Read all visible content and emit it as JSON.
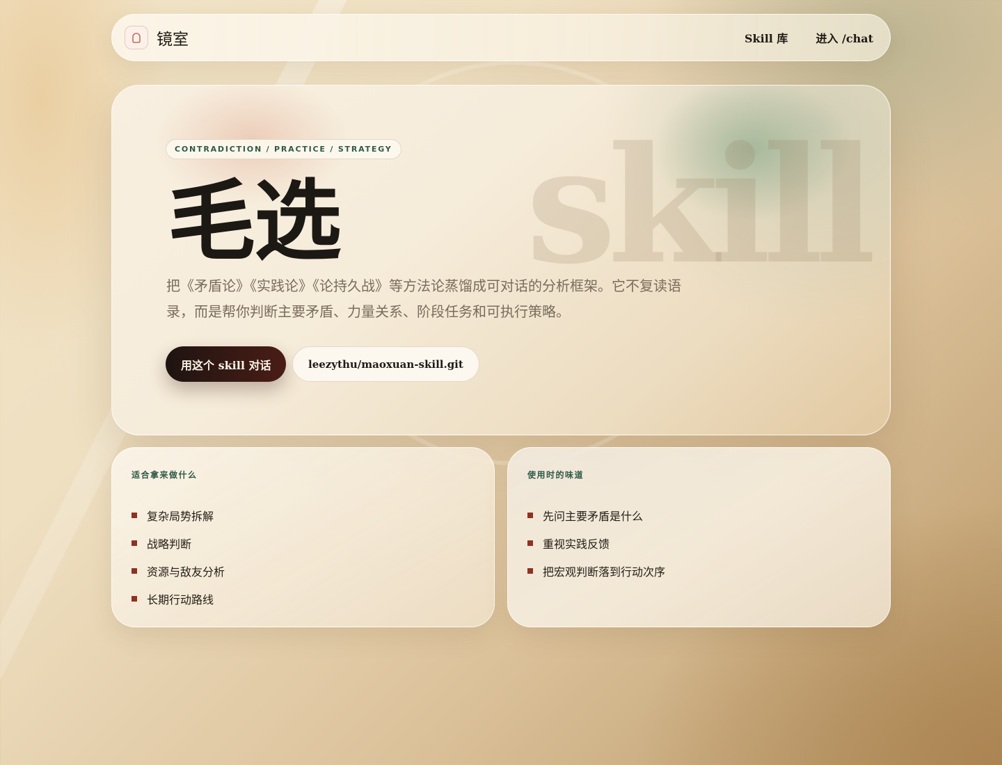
{
  "header": {
    "brand_name": "镜室",
    "nav": [
      {
        "label": "Skill 库"
      },
      {
        "label": "进入 /chat"
      }
    ]
  },
  "hero": {
    "eyebrow": "CONTRADICTION / PRACTICE / STRATEGY",
    "title": "毛选",
    "watermark": "skill",
    "description": "把《矛盾论》《实践论》《论持久战》等方法论蒸馏成可对话的分析框架。它不复读语录，而是帮你判断主要矛盾、力量关系、阶段任务和可执行策略。",
    "primary_button": "用这个 skill 对话",
    "secondary_button": "leezythu/maoxuan-skill.git"
  },
  "cards": [
    {
      "title": "适合拿来做什么",
      "items": [
        "复杂局势拆解",
        "战略判断",
        "资源与敌友分析",
        "长期行动路线"
      ]
    },
    {
      "title": "使用时的味道",
      "items": [
        "先问主要矛盾是什么",
        "重视实践反馈",
        "把宏观判断落到行动次序"
      ]
    }
  ],
  "colors": {
    "accent_green": "#2f5a48",
    "bullet_red": "#8e3223",
    "primary_button": "#2a1612"
  },
  "icons": {
    "brand": "mirror-icon"
  }
}
